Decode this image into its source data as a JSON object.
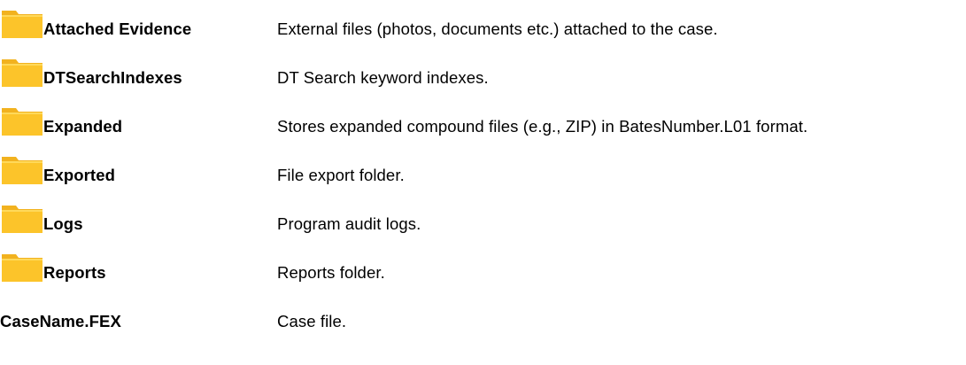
{
  "colors": {
    "folder_body": "#fcc42a",
    "folder_tab": "#f2b21f",
    "folder_highlight": "#ffd95a",
    "text": "#000000"
  },
  "entries": [
    {
      "name": "Attached Evidence",
      "description": "External files (photos, documents etc.) attached to the case.",
      "icon": "folder-icon"
    },
    {
      "name": "DTSearchIndexes",
      "description": "DT Search keyword indexes.",
      "icon": "folder-icon"
    },
    {
      "name": "Expanded",
      "description": "Stores expanded compound files (e.g., ZIP) in BatesNumber.L01 format.",
      "icon": "folder-icon"
    },
    {
      "name": "Exported",
      "description": "File export folder.",
      "icon": "folder-icon"
    },
    {
      "name": "Logs",
      "description": "Program audit logs.",
      "icon": "folder-icon"
    },
    {
      "name": "Reports",
      "description": "Reports folder.",
      "icon": "folder-icon"
    },
    {
      "name": "CaseName.FEX",
      "description": "Case file.",
      "icon": ""
    }
  ]
}
